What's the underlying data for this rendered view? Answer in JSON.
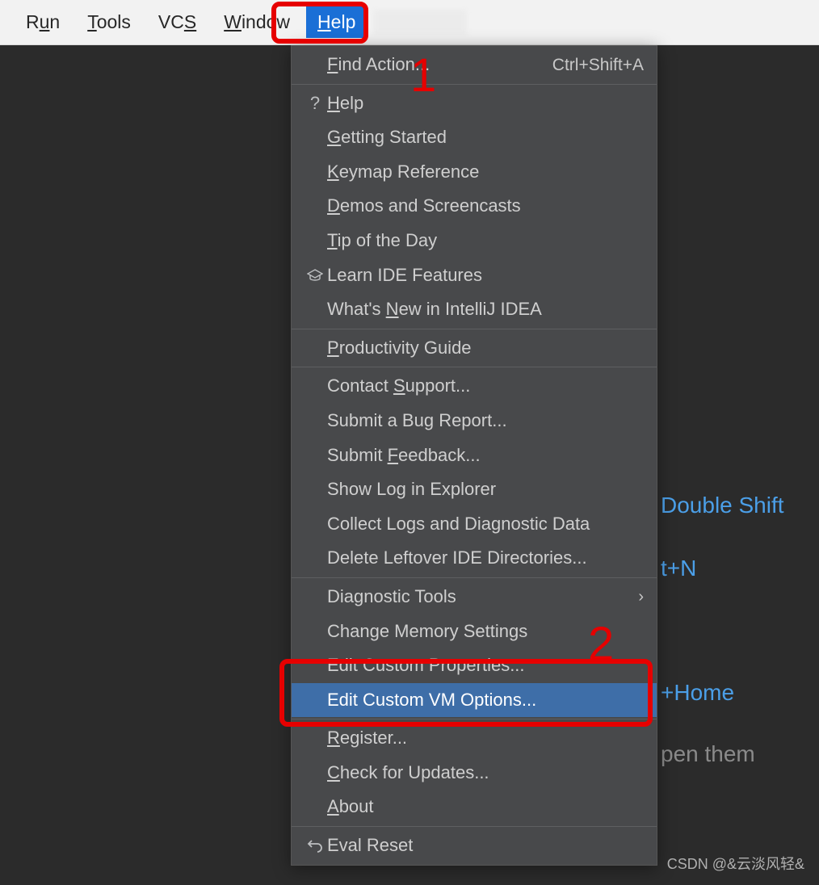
{
  "menubar": {
    "items": [
      {
        "pre": "R",
        "ul": "u",
        "post": "n"
      },
      {
        "pre": "",
        "ul": "T",
        "post": "ools"
      },
      {
        "pre": "VC",
        "ul": "S",
        "post": ""
      },
      {
        "pre": "",
        "ul": "W",
        "post": "indow"
      },
      {
        "pre": "",
        "ul": "H",
        "post": "elp",
        "selected": true
      }
    ]
  },
  "dropdown": {
    "rows": [
      {
        "type": "item",
        "pre": "",
        "ul": "F",
        "post": "ind Action...",
        "shortcut": "Ctrl+Shift+A"
      },
      {
        "type": "sep"
      },
      {
        "type": "item",
        "icon": "?",
        "pre": "",
        "ul": "H",
        "post": "elp"
      },
      {
        "type": "item",
        "pre": "",
        "ul": "G",
        "post": "etting Started"
      },
      {
        "type": "item",
        "pre": "",
        "ul": "K",
        "post": "eymap Reference"
      },
      {
        "type": "item",
        "pre": "",
        "ul": "D",
        "post": "emos and Screencasts"
      },
      {
        "type": "item",
        "pre": "",
        "ul": "T",
        "post": "ip of the Day"
      },
      {
        "type": "item",
        "icon": "grad",
        "pre": "Learn IDE Features"
      },
      {
        "type": "item",
        "pre": "What's ",
        "ul": "N",
        "post": "ew in IntelliJ IDEA"
      },
      {
        "type": "sep"
      },
      {
        "type": "item",
        "pre": "",
        "ul": "P",
        "post": "roductivity Guide"
      },
      {
        "type": "sep"
      },
      {
        "type": "item",
        "pre": "Contact ",
        "ul": "S",
        "post": "upport..."
      },
      {
        "type": "item",
        "pre": "Submit a Bug Report..."
      },
      {
        "type": "item",
        "pre": "Submit ",
        "ul": "F",
        "post": "eedback..."
      },
      {
        "type": "item",
        "pre": "Show Log in Explorer"
      },
      {
        "type": "item",
        "pre": "Collect Logs and Diagnostic Data"
      },
      {
        "type": "item",
        "pre": "Delete Leftover IDE Directories..."
      },
      {
        "type": "sep"
      },
      {
        "type": "item",
        "pre": "Diagnostic Tools",
        "submenu": true
      },
      {
        "type": "item",
        "pre": "Change Memory Settings"
      },
      {
        "type": "item",
        "pre": "Edit Custom Properties..."
      },
      {
        "type": "item",
        "pre": "Edit Custom VM Options...",
        "highlight": true
      },
      {
        "type": "sep"
      },
      {
        "type": "item",
        "pre": "",
        "ul": "R",
        "post": "egister..."
      },
      {
        "type": "item",
        "pre": "",
        "ul": "C",
        "post": "heck for Updates..."
      },
      {
        "type": "item",
        "pre": "",
        "ul": "A",
        "post": "bout"
      },
      {
        "type": "sep"
      },
      {
        "type": "item",
        "icon": "undo",
        "pre": "Eval Reset"
      }
    ]
  },
  "annotations": {
    "num1": "1",
    "num2": "2"
  },
  "background_hints": {
    "double_shift": "Double Shift",
    "t_n": "t+N",
    "home": "+Home",
    "open_them": "pen them"
  },
  "watermark": "CSDN @&云淡风轻&"
}
